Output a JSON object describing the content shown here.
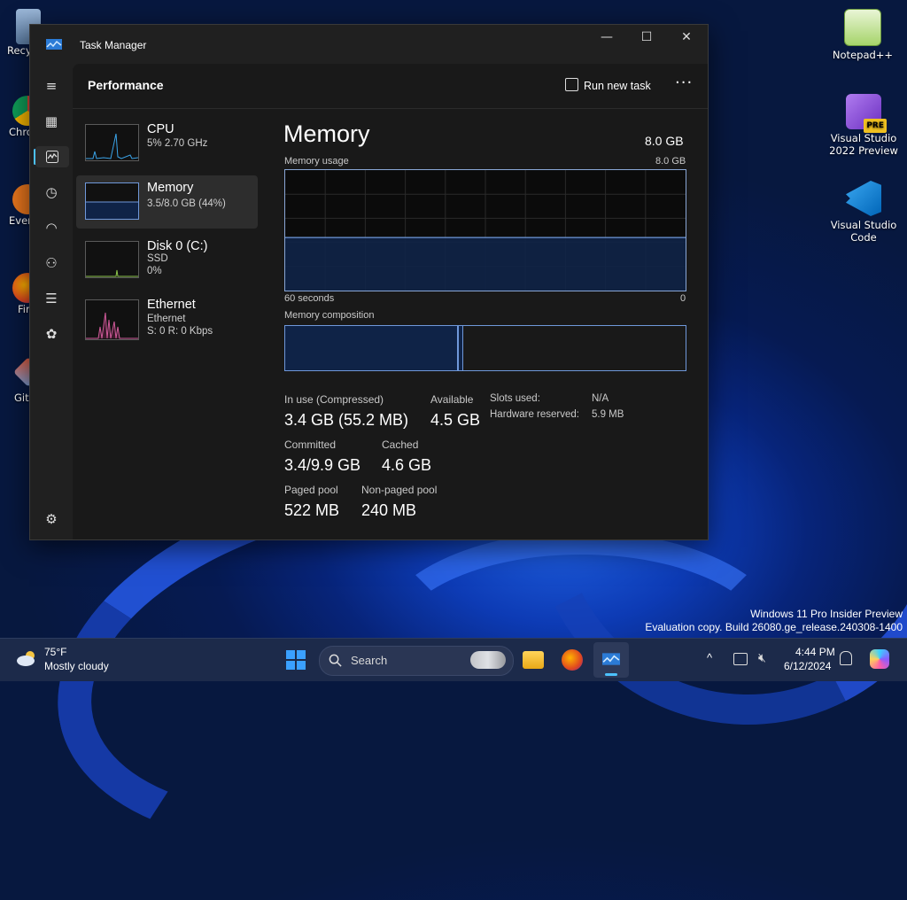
{
  "desktop": {
    "left_icons": [
      {
        "label": "Recy"
      },
      {
        "label": "Chro"
      },
      {
        "label": "Ever"
      },
      {
        "label": "Fir"
      },
      {
        "label": "Git"
      }
    ],
    "right_icons": [
      {
        "label": "Notepad++"
      },
      {
        "label": "Visual Studio 2022 Preview",
        "badge": "PRE"
      },
      {
        "label": "Visual Studio Code"
      }
    ],
    "watermark": {
      "line1": "Windows 11 Pro Insider Preview",
      "line2": "Evaluation copy. Build 26080.ge_release.240308-1400"
    }
  },
  "window": {
    "title": "Task Manager",
    "controls": {
      "minimize": "—",
      "maximize": "☐",
      "close": "✕"
    },
    "header": {
      "page_title": "Performance",
      "run_new_task": "Run new task",
      "more": "···"
    },
    "nav_icons": [
      "hamburger-icon",
      "processes-icon",
      "performance-icon",
      "app-history-icon",
      "startup-icon",
      "users-icon",
      "details-icon",
      "services-icon",
      "settings-icon"
    ],
    "cards": [
      {
        "name": "CPU",
        "sub1": "5%  2.70 GHz",
        "sub2": ""
      },
      {
        "name": "Memory",
        "sub1": "3.5/8.0 GB (44%)",
        "sub2": ""
      },
      {
        "name": "Disk 0 (C:)",
        "sub1": "SSD",
        "sub2": "0%"
      },
      {
        "name": "Ethernet",
        "sub1": "Ethernet",
        "sub2": "S: 0  R: 0 Kbps"
      }
    ],
    "memory": {
      "title": "Memory",
      "total": "8.0 GB",
      "usage_label": "Memory usage",
      "usage_max": "8.0 GB",
      "time_left": "60 seconds",
      "time_right": "0",
      "usage_fraction": 0.44,
      "composition_label": "Memory composition",
      "composition_in_use_fraction": 0.43,
      "stats": {
        "in_use_label": "In use (Compressed)",
        "in_use_value": "3.4 GB (55.2 MB)",
        "available_label": "Available",
        "available_value": "4.5 GB",
        "committed_label": "Committed",
        "committed_value": "3.4/9.9 GB",
        "cached_label": "Cached",
        "cached_value": "4.6 GB",
        "paged_label": "Paged pool",
        "paged_value": "522 MB",
        "nonpaged_label": "Non-paged pool",
        "nonpaged_value": "240 MB"
      },
      "kv": {
        "slots_label": "Slots used:",
        "slots_value": "N/A",
        "hw_label": "Hardware reserved:",
        "hw_value": "5.9 MB"
      }
    }
  },
  "taskbar": {
    "weather_temp": "75°F",
    "weather_desc": "Mostly cloudy",
    "search_placeholder": "Search",
    "time": "4:44 PM",
    "date": "6/12/2024",
    "tray_chevron": "^"
  },
  "colors": {
    "accent": "#4cc2ff",
    "graph_line": "#6f98da",
    "graph_fill": "#0f2347"
  }
}
